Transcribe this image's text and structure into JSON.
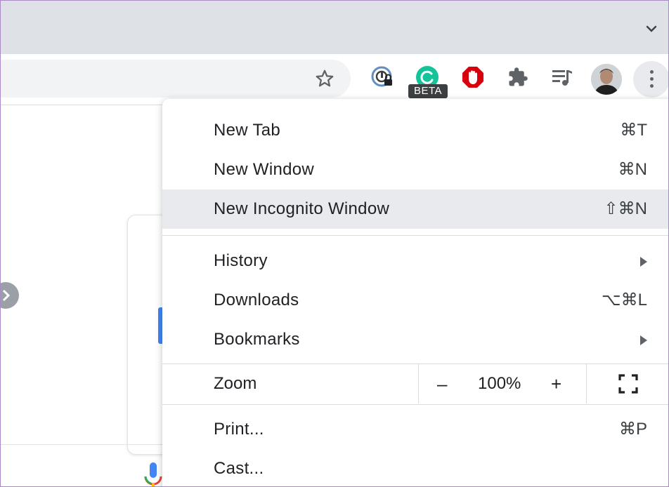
{
  "toolbar": {
    "beta_badge": "BETA"
  },
  "menu": {
    "items": [
      {
        "label": "New Tab",
        "shortcut": "⌘T"
      },
      {
        "label": "New Window",
        "shortcut": "⌘N"
      },
      {
        "label": "New Incognito Window",
        "shortcut": "⇧⌘N"
      },
      {
        "label": "History",
        "shortcut": ""
      },
      {
        "label": "Downloads",
        "shortcut": "⌥⌘L"
      },
      {
        "label": "Bookmarks",
        "shortcut": ""
      },
      {
        "label": "Print...",
        "shortcut": "⌘P"
      },
      {
        "label": "Cast...",
        "shortcut": ""
      }
    ],
    "zoom": {
      "label": "Zoom",
      "minus": "–",
      "value": "100%",
      "plus": "+"
    }
  },
  "icons": {
    "chevron": "chevron-down-icon",
    "star": "star-icon",
    "password": "password-manager-icon",
    "grammarly": "grammarly-icon",
    "adblock": "adblock-icon",
    "extensions": "puzzle-icon",
    "media": "media-control-icon",
    "menu": "kebab-menu-icon",
    "fullscreen": "fullscreen-icon",
    "mic": "microphone-icon"
  },
  "colors": {
    "tabstrip": "#dee1e6",
    "highlight": "#e8eaed",
    "grammarly": "#15c39a",
    "adblock": "#d9000d"
  }
}
